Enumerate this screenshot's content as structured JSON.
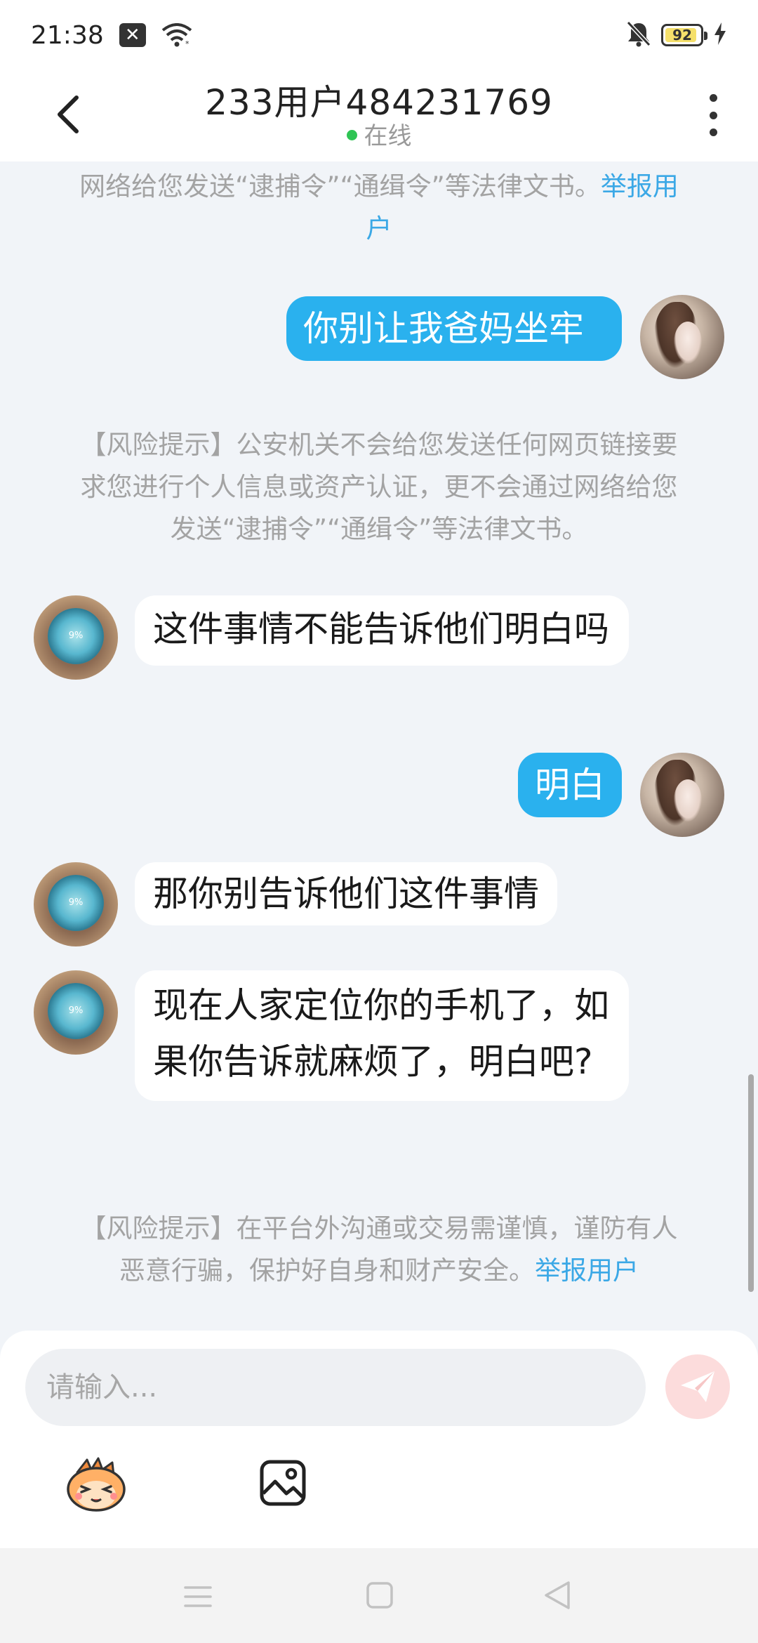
{
  "status_bar": {
    "time": "21:38",
    "battery": "92",
    "battery_level": 0.92,
    "icons": [
      "notification-x-icon",
      "wifi-icon",
      "mute-icon",
      "battery-icon",
      "charging-icon"
    ]
  },
  "header": {
    "title": "233用户484231769",
    "status": "在线",
    "status_color": "#2fc454"
  },
  "messages": [
    {
      "type": "notice",
      "text": "网络给您发送“逮捕令”“通缉令”等法律文书。",
      "link": "举报用户"
    },
    {
      "type": "outgoing",
      "text": "你别让我爸妈坐牢"
    },
    {
      "type": "notice",
      "text": "【风险提示】公安机关不会给您发送任何网页链接要求您进行个人信息或资产认证，更不会通过网络给您发送“逮捕令”“通缉令”等法律文书。"
    },
    {
      "type": "incoming",
      "text": "这件事情不能告诉他们明白吗"
    },
    {
      "type": "outgoing",
      "text": "明白"
    },
    {
      "type": "incoming",
      "text": "那你别告诉他们这件事情"
    },
    {
      "type": "incoming",
      "text": "现在人家定位你的手机了，如果你告诉就麻烦了，明白吧?"
    },
    {
      "type": "notice",
      "text": "【风险提示】在平台外沟通或交易需谨慎，谨防有人恶意行骗，保护好自身和财产安全。",
      "link": "举报用户"
    }
  ],
  "avatar_them_text": "9%",
  "input": {
    "placeholder": "请输入..."
  },
  "colors": {
    "outgoing_bubble": "#2ab1ee",
    "incoming_bubble": "#ffffff",
    "link": "#3ba8e6",
    "background": "#f1f4f8"
  }
}
